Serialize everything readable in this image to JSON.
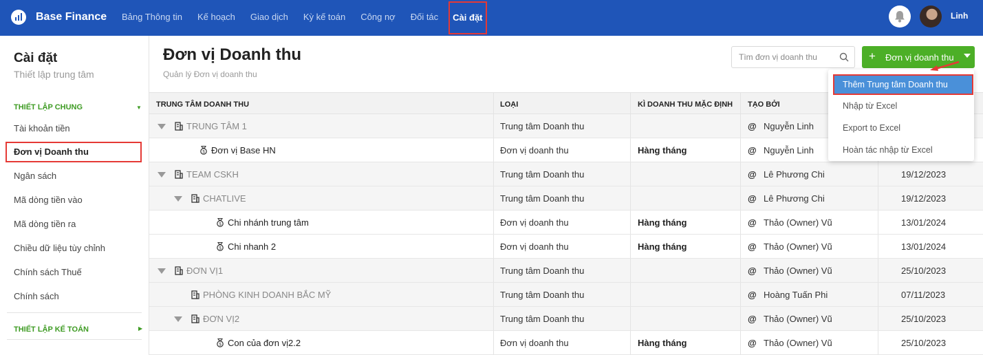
{
  "app": {
    "brand": "Base Finance",
    "user_name": "Linh"
  },
  "nav": {
    "items": [
      "Bảng Thông tin",
      "Kế hoạch",
      "Giao dịch",
      "Kỳ kế toán",
      "Công nợ",
      "Đối tác",
      "Cài đặt"
    ],
    "active": "Cài đặt"
  },
  "sidebar": {
    "title": "Cài đặt",
    "subtitle": "Thiết lập trung tâm",
    "section1": "THIẾT LẬP CHUNG",
    "items": [
      "Tài khoản tiền",
      "Đơn vị Doanh thu",
      "Ngân sách",
      "Mã dòng tiền vào",
      "Mã dòng tiền ra",
      "Chiều dữ liệu tùy chỉnh",
      "Chính sách Thuế",
      "Chính sách"
    ],
    "section2": "THIẾT LẬP KẾ TOÁN"
  },
  "page": {
    "title": "Đơn vị Doanh thu",
    "subtitle": "Quản lý Đơn vị doanh thu",
    "search_placeholder": "Tìm đơn vị doanh thu",
    "add_button": "Đơn vị doanh thu"
  },
  "table": {
    "headers": [
      "TRUNG TÂM DOANH THU",
      "LOẠI",
      "KÌ DOANH THU MẶC ĐỊNH",
      "TẠO BỞI"
    ],
    "rows": [
      {
        "name": "TRUNG TÂM 1",
        "kind": "group",
        "level": 0,
        "expand": true,
        "type": "Trung tâm Doanh thu",
        "period": "",
        "creator": "Nguyễn Linh",
        "date": ""
      },
      {
        "name": "Đơn vị Base HN",
        "kind": "unit",
        "level": 1,
        "expand": false,
        "type": "Đơn vị doanh thu",
        "period": "Hàng tháng",
        "creator": "Nguyễn Linh",
        "date": ""
      },
      {
        "name": "TEAM CSKH",
        "kind": "group",
        "level": 0,
        "expand": true,
        "type": "Trung tâm Doanh thu",
        "period": "",
        "creator": "Lê Phương Chi",
        "date": "19/12/2023"
      },
      {
        "name": "CHATLIVE",
        "kind": "group",
        "level": 1,
        "expand": true,
        "type": "Trung tâm Doanh thu",
        "period": "",
        "creator": "Lê Phương Chi",
        "date": "19/12/2023"
      },
      {
        "name": "Chi nhánh trung tâm",
        "kind": "unit",
        "level": 2,
        "expand": false,
        "type": "Đơn vị doanh thu",
        "period": "Hàng tháng",
        "creator": "Thảo (Owner) Vũ",
        "date": "13/01/2024"
      },
      {
        "name": "Chi nhanh 2",
        "kind": "unit",
        "level": 2,
        "expand": false,
        "type": "Đơn vị doanh thu",
        "period": "Hàng tháng",
        "creator": "Thảo (Owner) Vũ",
        "date": "13/01/2024"
      },
      {
        "name": "ĐƠN VỊ1",
        "kind": "group",
        "level": 0,
        "expand": true,
        "type": "Trung tâm Doanh thu",
        "period": "",
        "creator": "Thảo (Owner) Vũ",
        "date": "25/10/2023"
      },
      {
        "name": "PHÒNG KINH DOANH BẮC MỸ",
        "kind": "group",
        "level": 1,
        "expand": false,
        "type": "Trung tâm Doanh thu",
        "period": "",
        "creator": "Hoàng Tuấn Phi",
        "date": "07/11/2023"
      },
      {
        "name": "ĐƠN VỊ2",
        "kind": "group",
        "level": 1,
        "expand": true,
        "type": "Trung tâm Doanh thu",
        "period": "",
        "creator": "Thảo (Owner) Vũ",
        "date": "25/10/2023"
      },
      {
        "name": "Con của đơn vị2.2",
        "kind": "unit",
        "level": 2,
        "expand": false,
        "type": "Đơn vị doanh thu",
        "period": "Hàng tháng",
        "creator": "Thảo (Owner) Vũ",
        "date": "25/10/2023"
      }
    ]
  },
  "dropdown": {
    "items": [
      "Thêm Trung tâm Doanh thu",
      "Nhập từ Excel",
      "Export to Excel",
      "Hoàn tác nhập từ Excel"
    ]
  },
  "colors": {
    "topbar": "#1f55b8",
    "accent_green": "#4caf27",
    "highlight_red": "#e53935",
    "selected_blue": "#4a90d9"
  }
}
